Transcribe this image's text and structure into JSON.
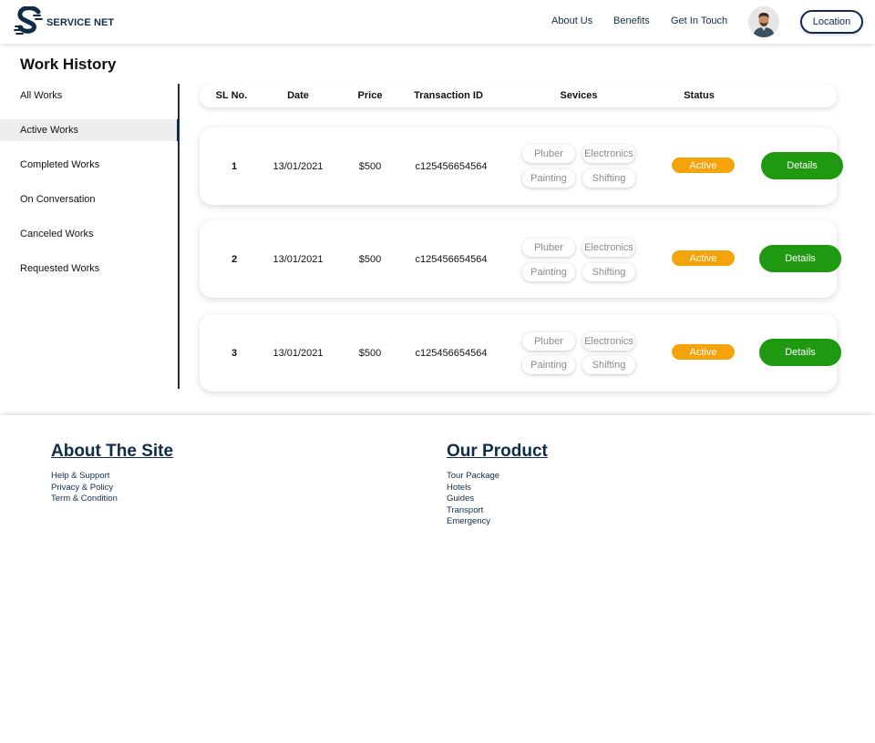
{
  "header": {
    "brand": "SERVICE NET",
    "nav": [
      "About Us",
      "Benefits",
      "Get In Touch"
    ],
    "location_label": "Location"
  },
  "page_title": "Work History",
  "sidebar": {
    "items": [
      {
        "label": "All Works",
        "active": false
      },
      {
        "label": "Active Works",
        "active": true
      },
      {
        "label": "Completed Works",
        "active": false
      },
      {
        "label": "On Conversation",
        "active": false
      },
      {
        "label": "Canceled Works",
        "active": false
      },
      {
        "label": "Requested Works",
        "active": false
      }
    ]
  },
  "table": {
    "headers": [
      "SL No.",
      "Date",
      "Price",
      "Transaction ID",
      "Sevices",
      "Status"
    ],
    "rows": [
      {
        "sl": "1",
        "date": "13/01/2021",
        "price": "$500",
        "txn": "c125456654564",
        "services": [
          "Pluber",
          "Electronics",
          "Painting",
          "Shifting"
        ],
        "status": "Active",
        "action": "Details"
      },
      {
        "sl": "2",
        "date": "13/01/2021",
        "price": "$500",
        "txn": "c125456654564",
        "services": [
          "Pluber",
          "Electronics",
          "Painting",
          "Shifting"
        ],
        "status": "Active",
        "action": "Details"
      },
      {
        "sl": "3",
        "date": "13/01/2021",
        "price": "$500",
        "txn": "c125456654564",
        "services": [
          "Pluber",
          "Electronics",
          "Painting",
          "Shifting"
        ],
        "status": "Active",
        "action": "Details"
      }
    ]
  },
  "footer": {
    "about": {
      "heading": "About The Site",
      "links": [
        "Help & Support",
        "Privacy & Policy",
        "Term & Condition"
      ]
    },
    "product": {
      "heading": "Our Product",
      "links": [
        "Tour Package",
        "Hotels",
        "Guides",
        "Transport",
        "Emergency"
      ]
    }
  },
  "colors": {
    "brand": "#0f2d4a",
    "status_active": "#f4a30b",
    "details_button": "#1f9a10"
  },
  "icons": {
    "logo": "service-net-logo-icon",
    "avatar": "user-avatar"
  }
}
